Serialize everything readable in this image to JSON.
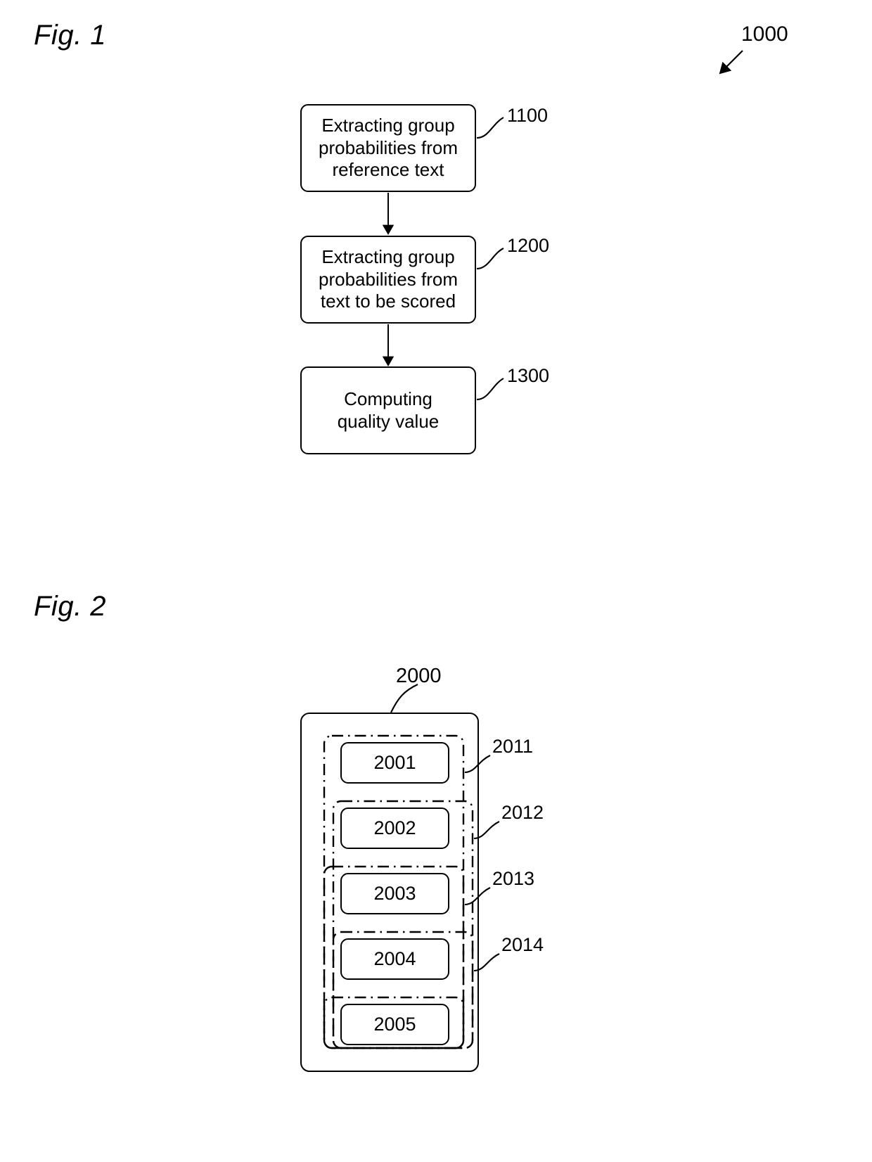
{
  "figures": [
    {
      "title": "Fig. 1",
      "overall_ref": "1000",
      "steps": [
        {
          "ref": "1100",
          "text": "Extracting group probabilities from reference text"
        },
        {
          "ref": "1200",
          "text": "Extracting group probabilities from text to be scored"
        },
        {
          "ref": "1300",
          "text": "Computing quality value"
        }
      ]
    },
    {
      "title": "Fig. 2",
      "overall_ref": "2000",
      "layers": [
        {
          "ref": "2011",
          "inner_ref": "2001"
        },
        {
          "ref": "2012",
          "inner_ref": "2002"
        },
        {
          "ref": "2013",
          "inner_ref": "2003"
        },
        {
          "ref": "2014",
          "inner_ref": "2004"
        }
      ],
      "final_ref": "2005"
    }
  ],
  "fig1": {
    "title": "Fig. 1",
    "ref_1000": "1000",
    "box1_text": "Extracting group probabilities from reference text",
    "box1_line1": "Extracting group",
    "box1_line2": "probabilities from",
    "box1_line3": "reference text",
    "box1_ref": "1100",
    "box2_line1": "Extracting group",
    "box2_line2": "probabilities from",
    "box2_line3": "text to be scored",
    "box2_ref": "1200",
    "box3_line1": "Computing",
    "box3_line2": "quality value",
    "box3_ref": "1300"
  },
  "fig2": {
    "title": "Fig. 2",
    "ref_2000": "2000",
    "ref_2011": "2011",
    "ref_2012": "2012",
    "ref_2013": "2013",
    "ref_2014": "2014",
    "label_2001": "2001",
    "label_2002": "2002",
    "label_2003": "2003",
    "label_2004": "2004",
    "label_2005": "2005"
  },
  "colors": {
    "ink": "#000000",
    "paper": "#ffffff"
  }
}
